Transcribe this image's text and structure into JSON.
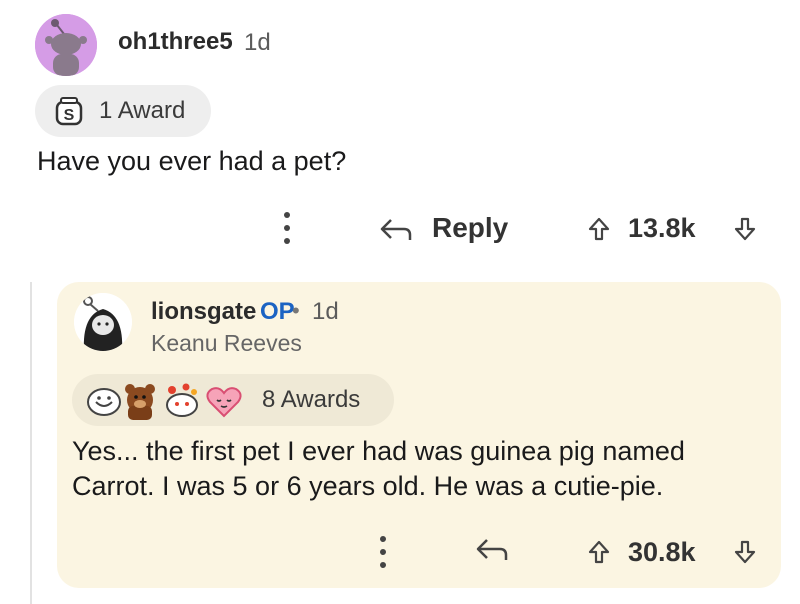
{
  "comment": {
    "username": "oh1three5",
    "time": "1d",
    "awards_label": "1 Award",
    "text": "Have you ever had a pet?",
    "more_label": "⋮",
    "reply_label": "Reply",
    "vote_count": "13.8k"
  },
  "reply": {
    "username": "lionsgate",
    "op_badge": "OP",
    "separator": "•",
    "time": "1d",
    "flair": "Keanu Reeves",
    "awards_label": "8 Awards",
    "text_line1": "Yes... the first pet I ever had was guinea pig named",
    "text_line2": "Carrot. I was 5 or 6 years old. He was a cutie-pie.",
    "more_label": "⋮",
    "vote_count": "30.8k"
  },
  "colors": {
    "op": "#1b63c3",
    "card_bg": "#fbf5e2",
    "avatar1_bg": "#d59ce6"
  },
  "icons": [
    "snoo-avatar",
    "silver-award-icon",
    "reply-icon",
    "upvote-icon",
    "downvote-icon",
    "more-options-icon",
    "keanu-avatar",
    "award-icons"
  ]
}
